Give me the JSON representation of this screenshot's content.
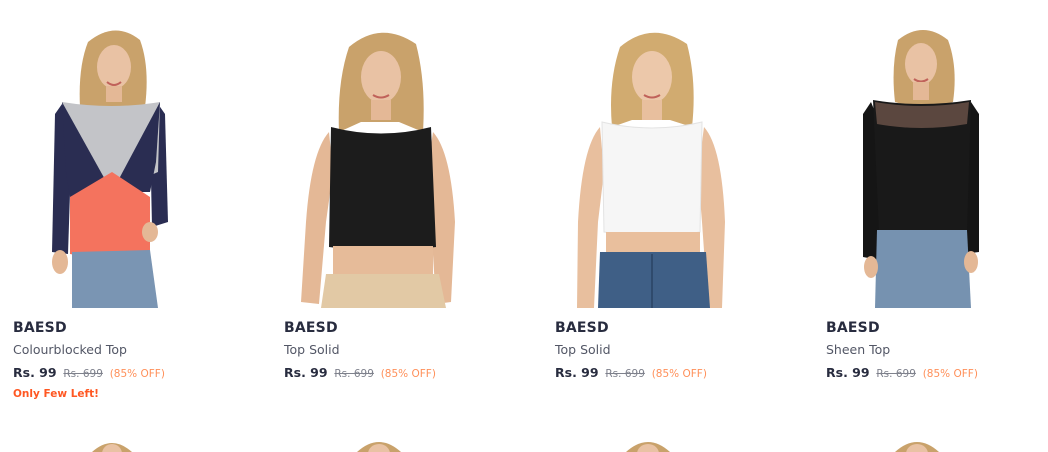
{
  "products": [
    {
      "brand": "BAESD",
      "name": "Colourblocked Top",
      "price": "Rs. 99",
      "mrp": "Rs. 699",
      "discount": "(85% OFF)",
      "stock_note": "Only Few Left!",
      "image": "woman-colourblocked-long-sleeve-top"
    },
    {
      "brand": "BAESD",
      "name": "Top Solid",
      "price": "Rs. 99",
      "mrp": "Rs. 699",
      "discount": "(85% OFF)",
      "image": "woman-black-sleeveless-crop-top"
    },
    {
      "brand": "BAESD",
      "name": "Top Solid",
      "price": "Rs. 99",
      "mrp": "Rs. 699",
      "discount": "(85% OFF)",
      "image": "woman-white-sleeveless-crop-top"
    },
    {
      "brand": "BAESD",
      "name": "Sheen Top",
      "price": "Rs. 99",
      "mrp": "Rs. 699",
      "discount": "(85% OFF)",
      "image": "woman-black-sheen-long-sleeve-top"
    }
  ],
  "colors": {
    "brand_text": "#282c3f",
    "name_text": "#535766",
    "mrp_text": "#7e818c",
    "discount_text": "#ff905a",
    "stock_text": "#ff5722"
  }
}
